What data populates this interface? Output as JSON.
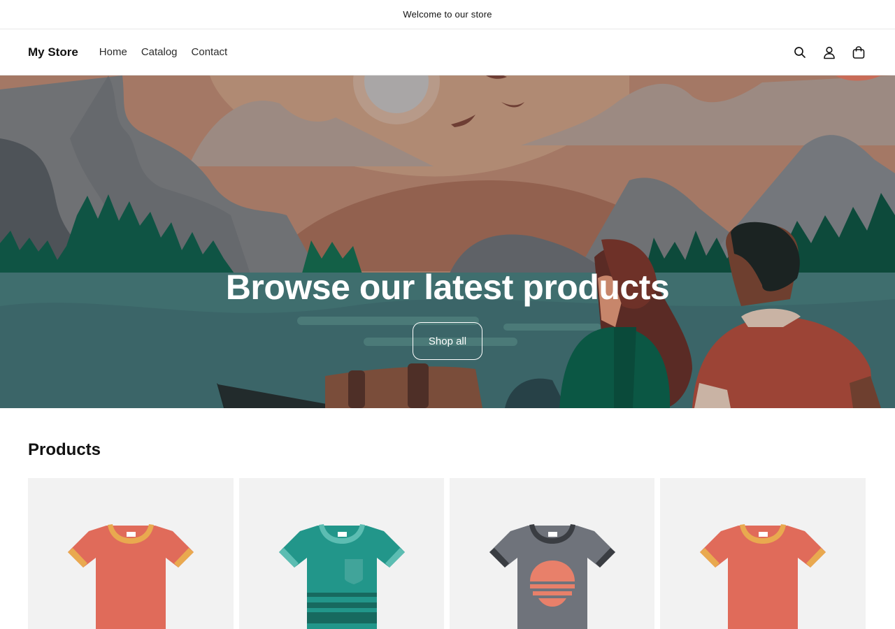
{
  "announcement": {
    "text": "Welcome to our store"
  },
  "header": {
    "logo": "My Store",
    "nav": [
      {
        "label": "Home"
      },
      {
        "label": "Catalog"
      },
      {
        "label": "Contact"
      }
    ],
    "icons": [
      "search-icon",
      "account-icon",
      "cart-icon"
    ]
  },
  "hero": {
    "title": "Browse our latest products",
    "button_label": "Shop all"
  },
  "products": {
    "title": "Products",
    "items": [
      {
        "shirt_color": "#e06b5a",
        "trim_color": "#e9a94f",
        "design": "plain"
      },
      {
        "shirt_color": "#22968a",
        "trim_color": "#5cbdb2",
        "design": "pocket-stripes"
      },
      {
        "shirt_color": "#6f737b",
        "trim_color": "#3a3d42",
        "design": "sunset-graphic"
      },
      {
        "shirt_color": "#e06b5a",
        "trim_color": "#e9a94f",
        "design": "plain"
      }
    ]
  },
  "colors": {
    "text": "#121212",
    "hero_water": "#3f6e6e",
    "hero_sky": "#a47865",
    "card_bg": "#f2f2f2"
  }
}
